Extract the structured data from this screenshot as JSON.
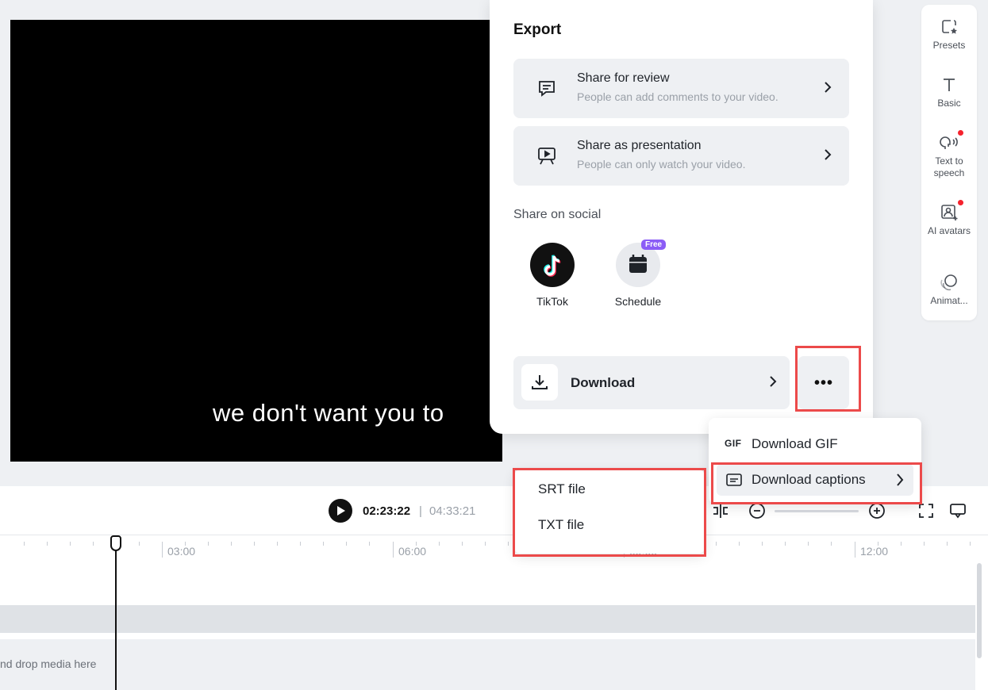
{
  "preview": {
    "caption": "we don't want you to"
  },
  "tools": [
    {
      "label": "Presets",
      "icon": "presets-icon"
    },
    {
      "label": "Basic",
      "icon": "text-icon"
    },
    {
      "label": "Text to speech",
      "icon": "text-to-speech-icon",
      "badge": true
    },
    {
      "label": "AI avatars",
      "icon": "ai-avatar-icon",
      "badge": true
    },
    {
      "label": "Animat...",
      "icon": "animation-icon"
    }
  ],
  "player": {
    "current_time": "02:23:22",
    "separator": "|",
    "total_time": "04:33:21"
  },
  "timeline": {
    "ticks": [
      "03:00",
      "06:00",
      "09:00",
      "12:00"
    ],
    "drop_hint": "nd drop media here"
  },
  "export": {
    "title": "Export",
    "share_review": {
      "title": "Share for review",
      "subtitle": "People can add comments to your video."
    },
    "share_presentation": {
      "title": "Share as presentation",
      "subtitle": "People can only watch your video."
    },
    "social_title": "Share on social",
    "social": [
      {
        "label": "TikTok",
        "icon": "tiktok-icon"
      },
      {
        "label": "Schedule",
        "icon": "calendar-icon",
        "badge": "Free"
      }
    ],
    "download_label": "Download",
    "more_label": "•••"
  },
  "more_menu": {
    "items": [
      {
        "tag": "GIF",
        "label": "Download GIF"
      },
      {
        "label": "Download captions",
        "icon": "captions-icon"
      }
    ]
  },
  "captions_submenu": {
    "items": [
      "SRT file",
      "TXT file"
    ]
  },
  "colors": {
    "highlight": "#ec4a4a",
    "badge_red": "#f5222d",
    "free_badge": "#8b5cf6"
  }
}
